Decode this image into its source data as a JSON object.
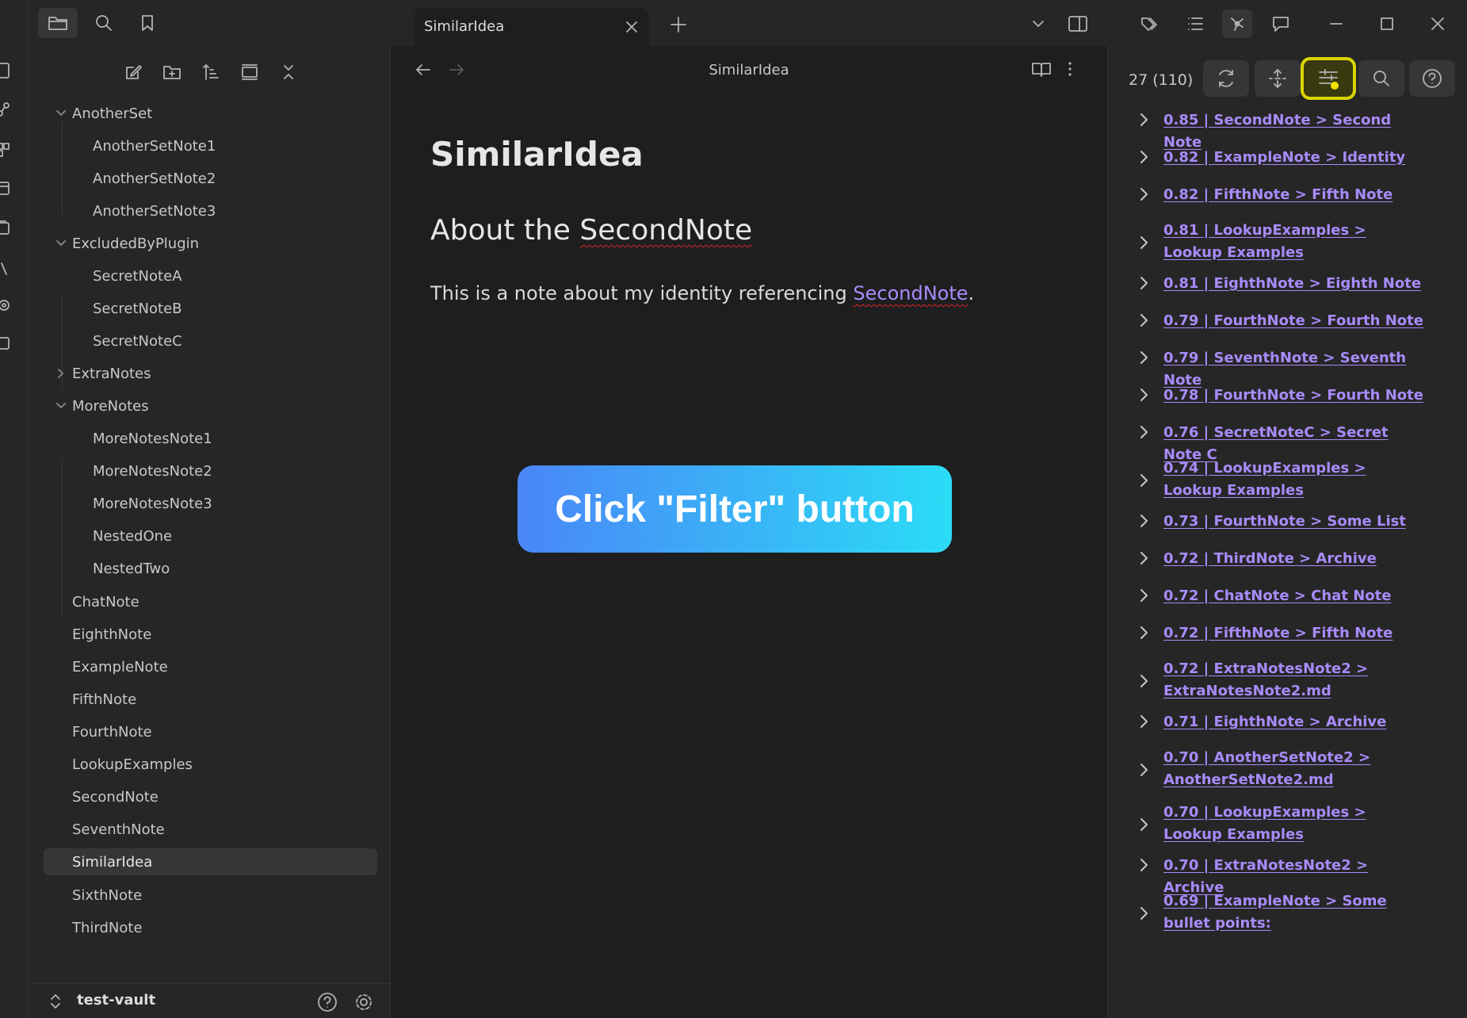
{
  "ribbon": {
    "icons": [
      "file-icon",
      "graph-icon",
      "layout-icon",
      "calendar-icon",
      "copy-icon",
      "command-icon",
      "settings-icon",
      "sidebar-icon"
    ]
  },
  "topbar": {
    "left_icons": [
      "folder-icon",
      "search-icon",
      "bookmark-icon"
    ],
    "tab_title": "SimilarIdea",
    "right_icons": [
      "chevron-down-icon",
      "split-view-icon",
      "tags-icon",
      "list-icon",
      "graph-icon",
      "comment-icon",
      "minimize-icon",
      "maximize-icon",
      "close-icon"
    ]
  },
  "sidebar": {
    "actions": [
      "new-note-icon",
      "new-folder-icon",
      "sort-icon",
      "collapse-view-icon",
      "collapse-all-icon"
    ],
    "tree": [
      {
        "label": "AnotherSet",
        "type": "folder",
        "expanded": true,
        "depth": 0
      },
      {
        "label": "AnotherSetNote1",
        "type": "file",
        "depth": 1
      },
      {
        "label": "AnotherSetNote2",
        "type": "file",
        "depth": 1
      },
      {
        "label": "AnotherSetNote3",
        "type": "file",
        "depth": 1
      },
      {
        "label": "ExcludedByPlugin",
        "type": "folder",
        "expanded": true,
        "depth": 0
      },
      {
        "label": "SecretNoteA",
        "type": "file",
        "depth": 1
      },
      {
        "label": "SecretNoteB",
        "type": "file",
        "depth": 1
      },
      {
        "label": "SecretNoteC",
        "type": "file",
        "depth": 1
      },
      {
        "label": "ExtraNotes",
        "type": "folder",
        "expanded": false,
        "depth": 0
      },
      {
        "label": "MoreNotes",
        "type": "folder",
        "expanded": true,
        "depth": 0
      },
      {
        "label": "MoreNotesNote1",
        "type": "file",
        "depth": 1
      },
      {
        "label": "MoreNotesNote2",
        "type": "file",
        "depth": 1
      },
      {
        "label": "MoreNotesNote3",
        "type": "file",
        "depth": 1
      },
      {
        "label": "NestedOne",
        "type": "file",
        "depth": 1
      },
      {
        "label": "NestedTwo",
        "type": "file",
        "depth": 1
      },
      {
        "label": "ChatNote",
        "type": "file",
        "depth": 0
      },
      {
        "label": "EighthNote",
        "type": "file",
        "depth": 0
      },
      {
        "label": "ExampleNote",
        "type": "file",
        "depth": 0
      },
      {
        "label": "FifthNote",
        "type": "file",
        "depth": 0
      },
      {
        "label": "FourthNote",
        "type": "file",
        "depth": 0
      },
      {
        "label": "LookupExamples",
        "type": "file",
        "depth": 0
      },
      {
        "label": "SecondNote",
        "type": "file",
        "depth": 0
      },
      {
        "label": "SeventhNote",
        "type": "file",
        "depth": 0
      },
      {
        "label": "SimilarIdea",
        "type": "file",
        "depth": 0,
        "active": true
      },
      {
        "label": "SixthNote",
        "type": "file",
        "depth": 0
      },
      {
        "label": "ThirdNote",
        "type": "file",
        "depth": 0
      }
    ],
    "vault_name": "test-vault"
  },
  "editor": {
    "view_title": "SimilarIdea",
    "note_title": "SimilarIdea",
    "heading_prefix": "About the ",
    "heading_link": "SecondNote",
    "paragraph_prefix": "This is a note about my identity referencing ",
    "paragraph_link": "SecondNote",
    "paragraph_suffix": "."
  },
  "callout": {
    "text": "Click \"Filter\" button",
    "gradient_start": "#4a86f7",
    "gradient_end": "#2bdcf6"
  },
  "right_panel": {
    "count": "27 (110)",
    "buttons": [
      "refresh-icon",
      "expand-collapse-icon",
      "filter-icon",
      "search-icon",
      "help-icon"
    ],
    "highlight_color": "#d9d400",
    "link_color": "#a88bfa",
    "results": [
      "0.85 | SecondNote > Second Note",
      "0.82 | ExampleNote > Identity",
      "0.82 | FifthNote > Fifth Note",
      "0.81 | LookupExamples > Lookup Examples",
      "0.81 | EighthNote > Eighth Note",
      "0.79 | FourthNote > Fourth Note",
      "0.79 | SeventhNote > Seventh Note",
      "0.78 | FourthNote > Fourth Note",
      "0.76 | SecretNoteC > Secret Note C",
      "0.74 | LookupExamples > Lookup Examples",
      "0.73 | FourthNote > Some List",
      "0.72 | ThirdNote > Archive",
      "0.72 | ChatNote > Chat Note",
      "0.72 | FifthNote > Fifth Note",
      "0.72 | ExtraNotesNote2 > ExtraNotesNote2.md",
      "0.71 | EighthNote > Archive",
      "0.70 | AnotherSetNote2 > AnotherSetNote2.md",
      "0.70 | LookupExamples > Lookup Examples",
      "0.70 | ExtraNotesNote2 > Archive",
      "0.69 | ExampleNote > Some bullet points:"
    ]
  }
}
